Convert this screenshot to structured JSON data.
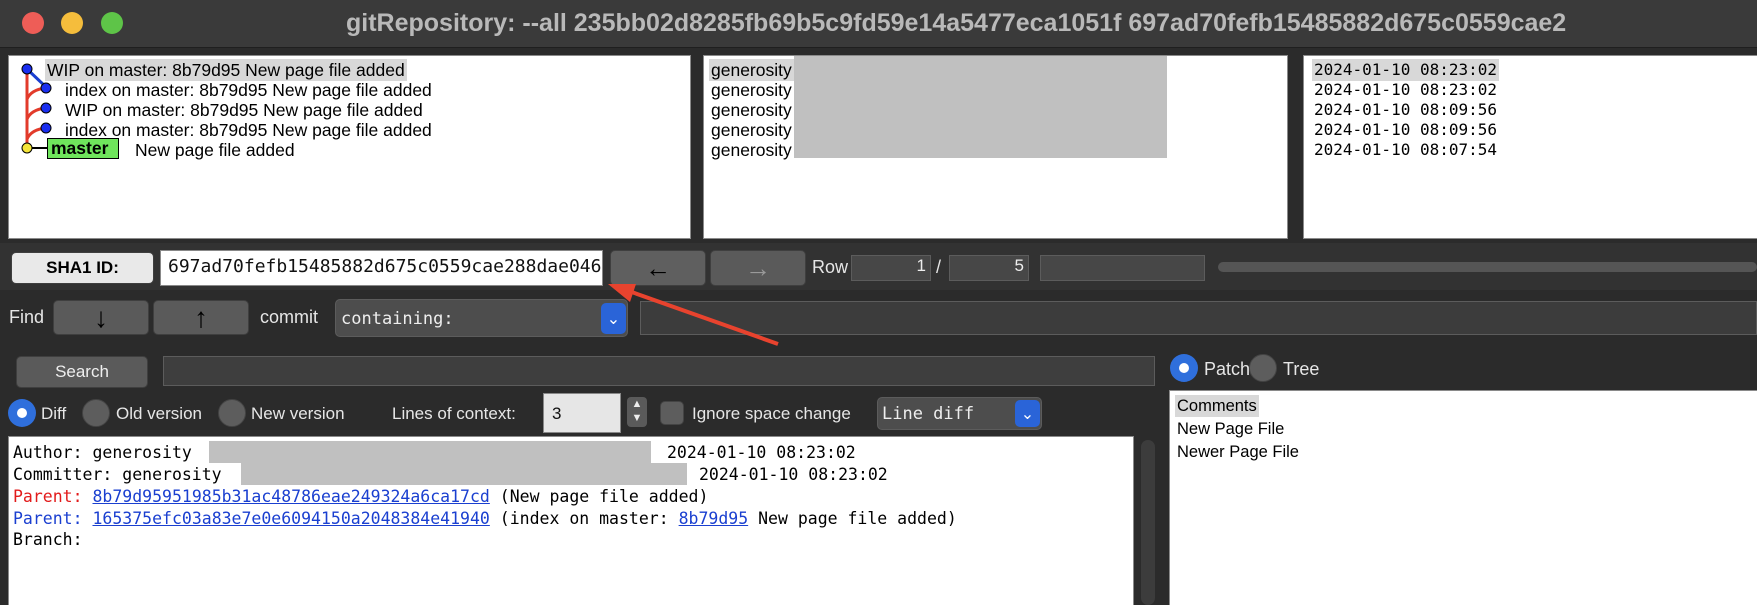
{
  "window": {
    "title": "gitRepository: --all 235bb02d8285fb69b5c9fd59e14a5477eca1051f 697ad70fefb15485882d675c0559cae2"
  },
  "commits": [
    {
      "message": "WIP on master: 8b79d95 New page file added",
      "author": "generosity",
      "date": "2024-01-10 08:23:02"
    },
    {
      "message": "index on master: 8b79d95 New page file added",
      "author": "generosity",
      "date": "2024-01-10 08:23:02"
    },
    {
      "message": "WIP on master: 8b79d95 New page file added",
      "author": "generosity",
      "date": "2024-01-10 08:09:56"
    },
    {
      "message": "index on master: 8b79d95 New page file added",
      "author": "generosity",
      "date": "2024-01-10 08:09:56"
    },
    {
      "message": "New page file added",
      "author": "generosity",
      "date": "2024-01-10 08:07:54",
      "branch": "master"
    }
  ],
  "sha": {
    "label": "SHA1 ID:",
    "value": "697ad70fefb15485882d675c0559cae288dae046"
  },
  "row": {
    "label": "Row",
    "current": "1",
    "sep": "/",
    "total": "5"
  },
  "find": {
    "label": "Find",
    "type": "commit",
    "mode": "containing:"
  },
  "search": {
    "button": "Search"
  },
  "view": {
    "diff": "Diff",
    "old": "Old version",
    "new": "New version",
    "context_label": "Lines of context:",
    "context_value": "3",
    "ignore": "Ignore space change",
    "diff_mode": "Line diff"
  },
  "tree": {
    "patch": "Patch",
    "tree": "Tree",
    "files": [
      "Comments",
      "New Page File",
      "Newer Page File"
    ]
  },
  "details": {
    "author_label": "Author: generosity",
    "author_date": "2024-01-10 08:23:02",
    "committer_label": "Committer: generosity",
    "committer_date": "2024-01-10 08:23:02",
    "parent1_label": "Parent:",
    "parent1_sha": "8b79d95951985b31ac48786eae249324a6ca17cd",
    "parent1_desc": "(New page file added)",
    "parent2_label": "Parent:",
    "parent2_sha": "165375efc03a83e7e0e6094150a2048384e41940",
    "parent2_desc_pre": "(index on master:",
    "parent2_link": "8b79d95",
    "parent2_desc_post": "New page file added)",
    "branch_label": "Branch:"
  }
}
